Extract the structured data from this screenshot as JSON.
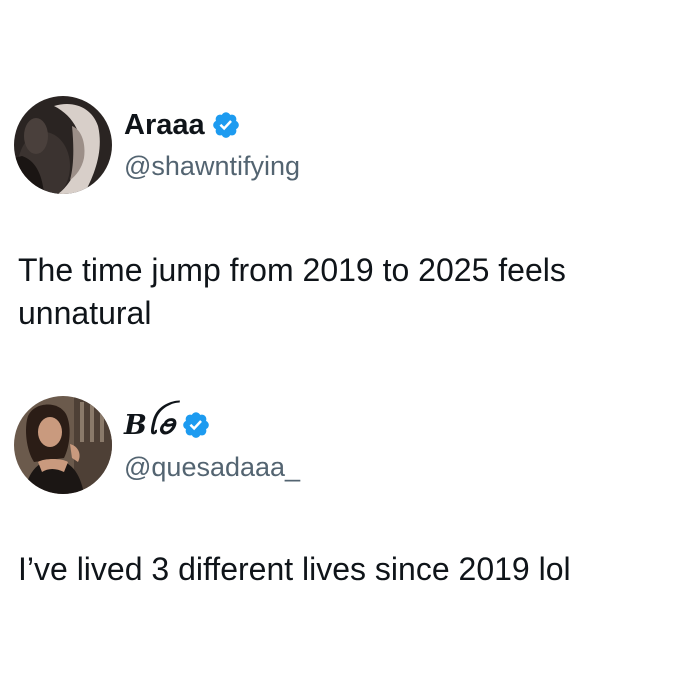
{
  "tweets": [
    {
      "display_name": "Araaa",
      "handle": "@shawntifying",
      "verified": true,
      "verified_icon": "verified-badge-icon",
      "text": "The time jump from 2019 to 2025 feels unnatural"
    },
    {
      "display_name": "Bꪶꪮ",
      "handle": "@quesadaaa_",
      "verified": true,
      "verified_icon": "verified-badge-icon",
      "text": "I’ve lived 3 different lives since 2019 lol"
    }
  ],
  "colors": {
    "verified_blue": "#1d9bf0",
    "handle_gray": "#536471",
    "text": "#0f1419",
    "background": "#ffffff"
  }
}
